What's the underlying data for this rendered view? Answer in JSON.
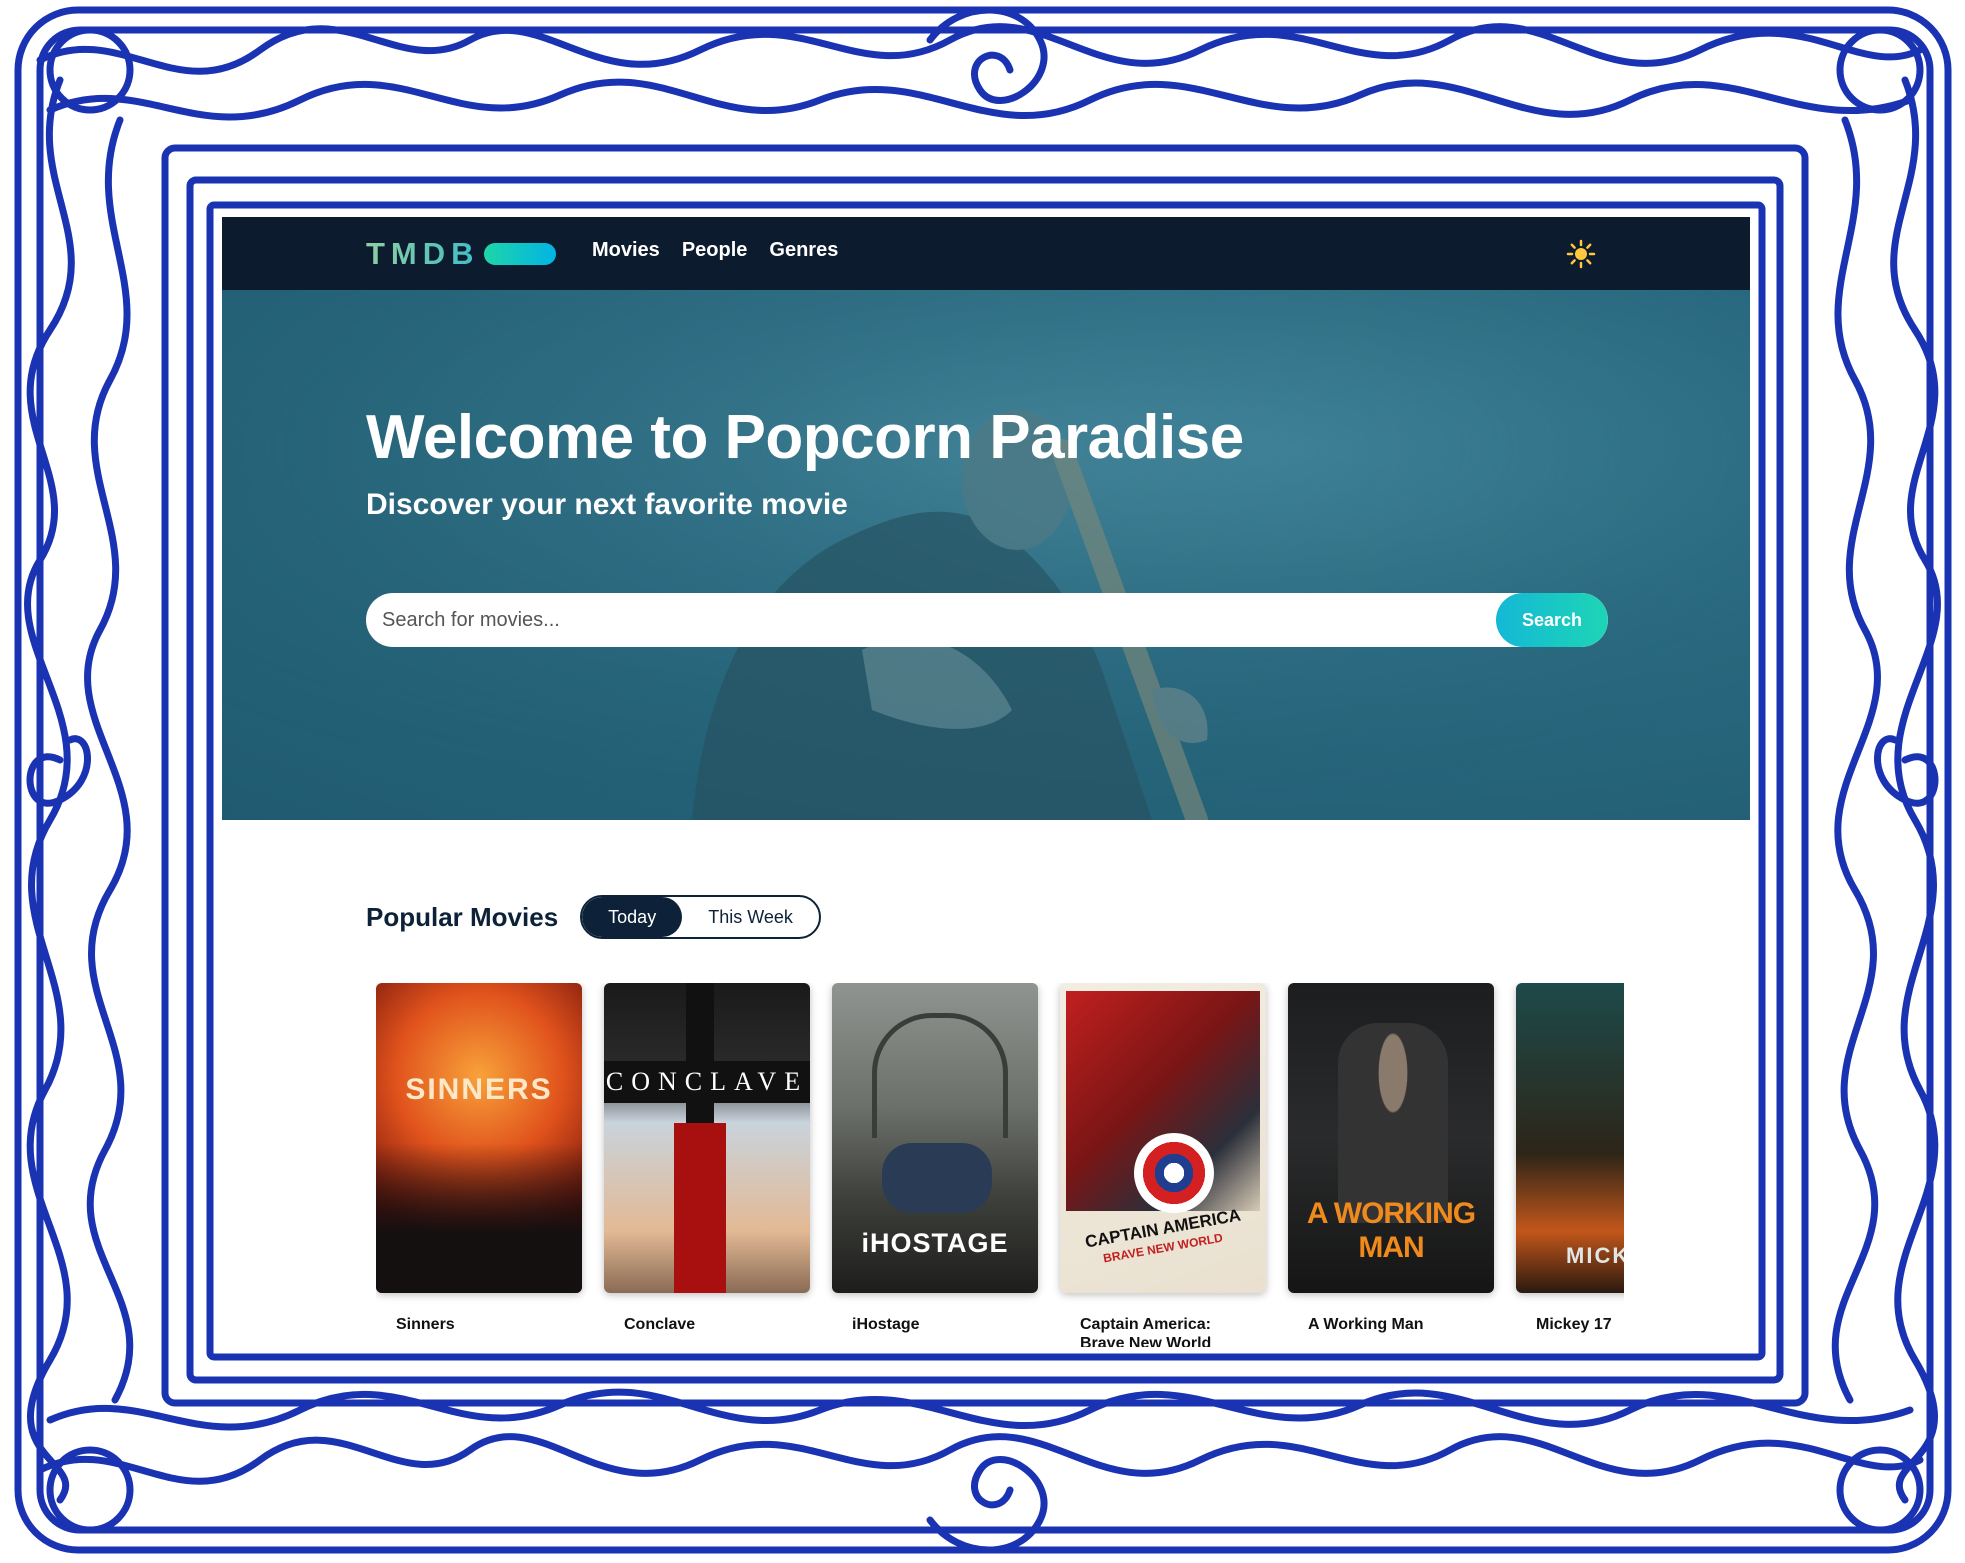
{
  "nav": {
    "logo": "TMDB",
    "links": [
      "Movies",
      "People",
      "Genres"
    ],
    "theme_icon": "sun-icon"
  },
  "hero": {
    "title": "Welcome to Popcorn Paradise",
    "subtitle": "Discover your next favorite movie",
    "search_placeholder": "Search for movies...",
    "search_button": "Search"
  },
  "popular": {
    "title": "Popular Movies",
    "toggle": [
      "Today",
      "This Week"
    ],
    "active": "Today",
    "movies": [
      {
        "title": "Sinners",
        "poster_text": "SINNERS"
      },
      {
        "title": "Conclave",
        "poster_text": "CONCLAVE"
      },
      {
        "title": "iHostage",
        "poster_text": "iHOSTAGE"
      },
      {
        "title": "Captain America: Brave New World",
        "poster_text": "CAPTAIN AMERICA",
        "poster_subtext": "BRAVE NEW WORLD"
      },
      {
        "title": "A Working Man",
        "poster_text": "A WORKING MAN"
      },
      {
        "title": "Mickey 17",
        "poster_text": "MICK"
      }
    ]
  },
  "colors": {
    "nav_bg": "#0d1b2e",
    "hero_bg": "#2a6a80",
    "accent": "#1ed5a9",
    "frame": "#1a33b3"
  }
}
